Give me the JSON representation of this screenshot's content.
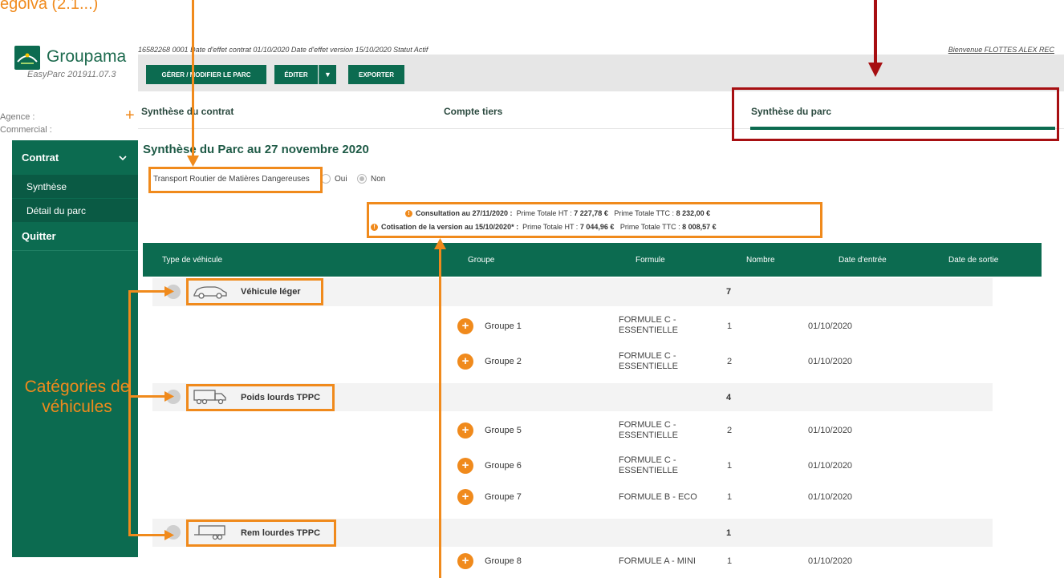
{
  "annotation_fragment": "égoiva (2.1...)",
  "logo": {
    "name": "Groupama",
    "version": "EasyParc 201911.07.3"
  },
  "agency": {
    "agence_label": "Agence :",
    "commercial_label": "Commercial :"
  },
  "sidebar": {
    "contrat": "Contrat",
    "items": [
      "Synthèse",
      "Détail du parc"
    ],
    "quitter": "Quitter"
  },
  "contract_info": "16582268 0001   Date d'effet contrat 01/10/2020   Date d'effet version 15/10/2020   Statut Actif",
  "welcome": "Bienvenue FLOTTES ALEX REC",
  "toolbar": {
    "gerer": "GÉRER / MODIFIER LE PARC",
    "editer": "ÉDITER",
    "exporter": "EXPORTER"
  },
  "tabs": [
    "Synthèse du contrat",
    "Compte tiers",
    "Synthèse du parc"
  ],
  "page_title": "Synthèse du Parc au 27 novembre 2020",
  "tmd": {
    "label": "Transport Routier de Matières Dangereuses",
    "oui": "Oui",
    "non": "Non"
  },
  "primes": {
    "consultation": {
      "label": "Consultation au 27/11/2020 :",
      "ht_label": "Prime Totale HT :",
      "ht": "7 227,78 €",
      "ttc_label": "Prime Totale TTC :",
      "ttc": "8 232,00 €"
    },
    "cotisation": {
      "label": "Cotisation de la version au 15/10/2020* :",
      "ht_label": "Prime Totale HT :",
      "ht": "7 044,96 €",
      "ttc_label": "Prime Totale TTC :",
      "ttc": "8 008,57 €"
    }
  },
  "table": {
    "headers": [
      "Type de véhicule",
      "Groupe",
      "Formule",
      "Nombre",
      "Date d'entrée",
      "Date de sortie"
    ],
    "categories": [
      {
        "label": "Véhicule léger",
        "count": "7"
      },
      {
        "label": "Poids lourds TPPC",
        "count": "4"
      },
      {
        "label": "Rem lourdes TPPC",
        "count": "1"
      }
    ],
    "groups": [
      {
        "label": "Groupe 1",
        "formula": "FORMULE C - ESSENTIELLE",
        "count": "1",
        "date": "01/10/2020"
      },
      {
        "label": "Groupe 2",
        "formula": "FORMULE C - ESSENTIELLE",
        "count": "2",
        "date": "01/10/2020"
      },
      {
        "label": "Groupe 5",
        "formula": "FORMULE C - ESSENTIELLE",
        "count": "2",
        "date": "01/10/2020"
      },
      {
        "label": "Groupe 6",
        "formula": "FORMULE C - ESSENTIELLE",
        "count": "1",
        "date": "01/10/2020"
      },
      {
        "label": "Groupe 7",
        "formula": "FORMULE B - ECO",
        "count": "1",
        "date": "01/10/2020"
      },
      {
        "label": "Groupe 8",
        "formula": "FORMULE A - MINI",
        "count": "1",
        "date": "01/10/2020"
      }
    ]
  },
  "annotation_categories": "Catégories de véhicules",
  "colors": {
    "brand_green": "#0c6b50",
    "annotation_orange": "#f08a1c",
    "highlight_red": "#a70f12"
  }
}
